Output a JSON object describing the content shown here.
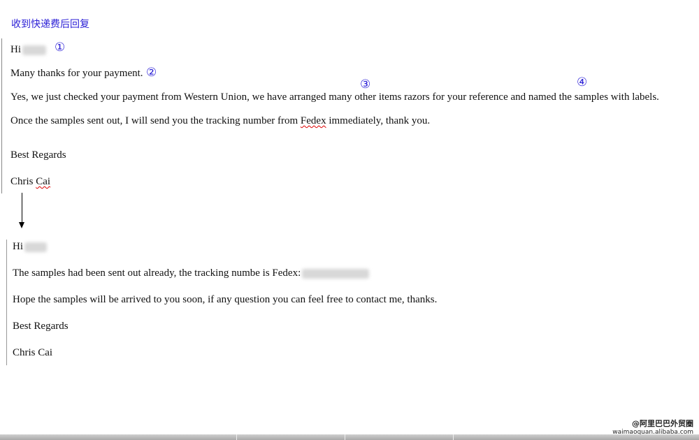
{
  "heading": "收到快递费后回复",
  "email1": {
    "greeting": "Hi",
    "line1": "Many thanks for your payment.",
    "line2a": "Yes, we just checked your payment from Western Union, we have arranged many other items razors for your reference and named the samples with labels.",
    "line3_pre": "Once the samples sent out, I will send you the tracking number from ",
    "line3_fedex": "Fedex",
    "line3_post": " immediately, thank you.",
    "regards": "Best Regards",
    "sign_first": "Chris ",
    "sign_last": "Cai"
  },
  "markers": {
    "m1": "①",
    "m2": "②",
    "m3": "③",
    "m4": "④"
  },
  "email2": {
    "greeting": "Hi",
    "line1": "The samples had been sent out already, the tracking numbe is Fedex:",
    "line2": "Hope the samples will be arrived to you soon, if any question you can feel free to contact me, thanks.",
    "regards": "Best Regards",
    "signature": "Chris Cai"
  },
  "watermark": {
    "line1": "@阿里巴巴外贸圈",
    "line2": "waimaoquan.alibaba.com"
  },
  "colors": {
    "accent": "#2b1fd6",
    "spellcheck": "#d00000"
  }
}
